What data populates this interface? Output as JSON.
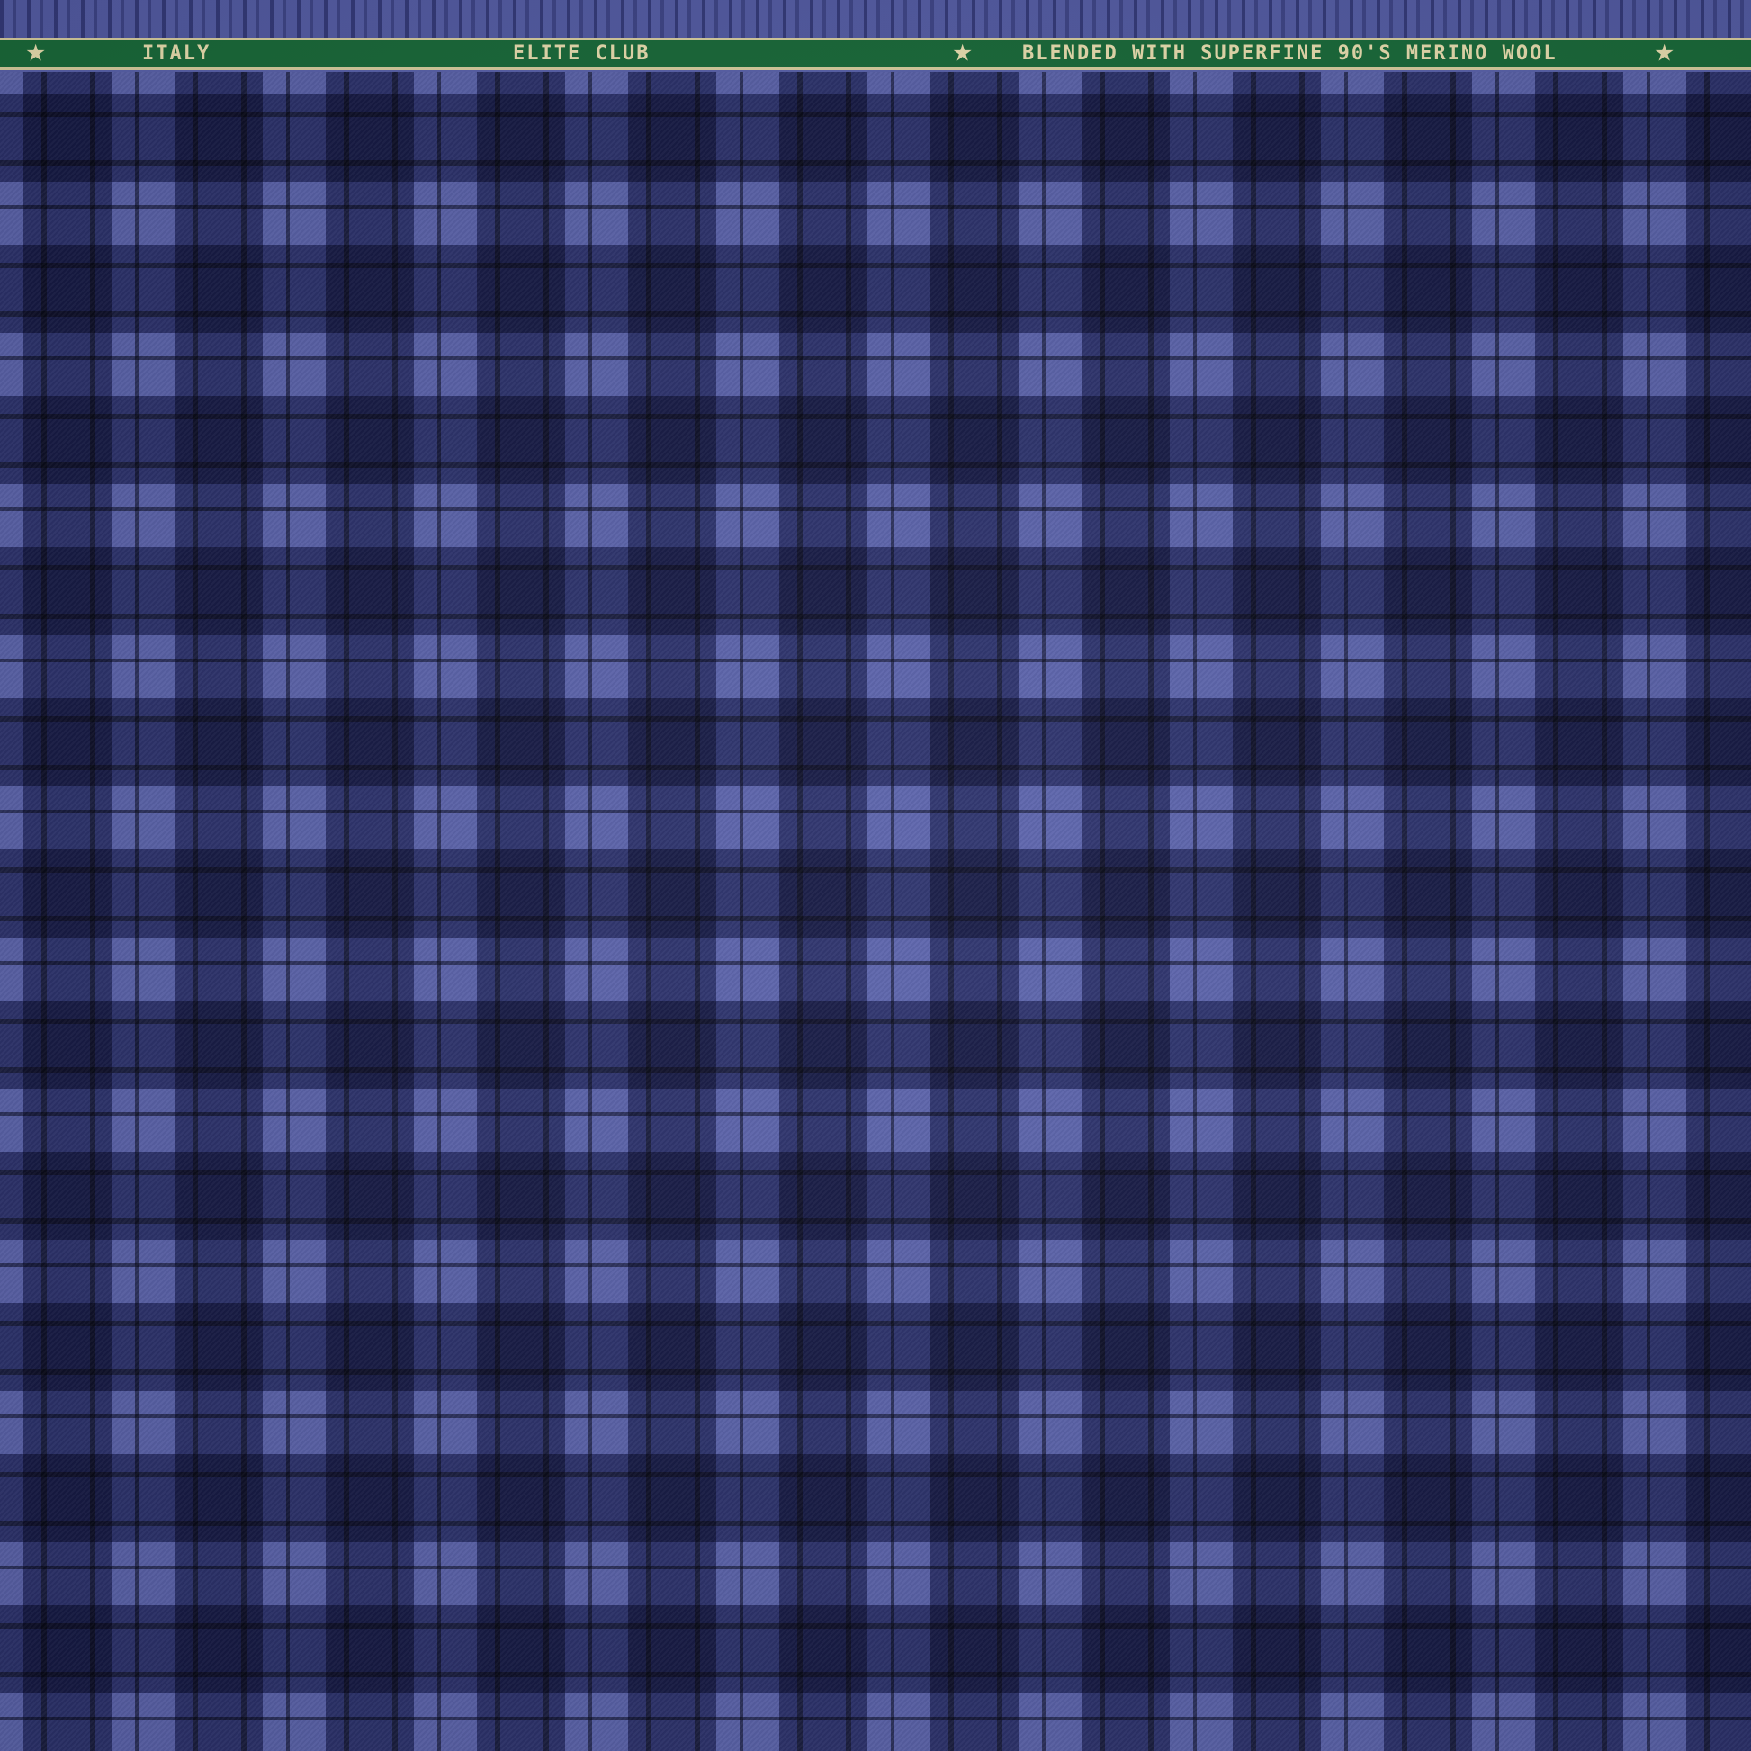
{
  "fabric": {
    "base_color": "#5a62ab",
    "dark_check_color": "#1c2462",
    "selvedge_color": "#1a6a3a",
    "selvedge_text_color": "#eadfb0"
  },
  "selvedge": {
    "label_1": "ITALY",
    "label_2": "ELITE CLUB",
    "label_3": "BLENDED WITH SUPERFINE 90'S MERINO WOOL",
    "star_glyph": "★"
  }
}
